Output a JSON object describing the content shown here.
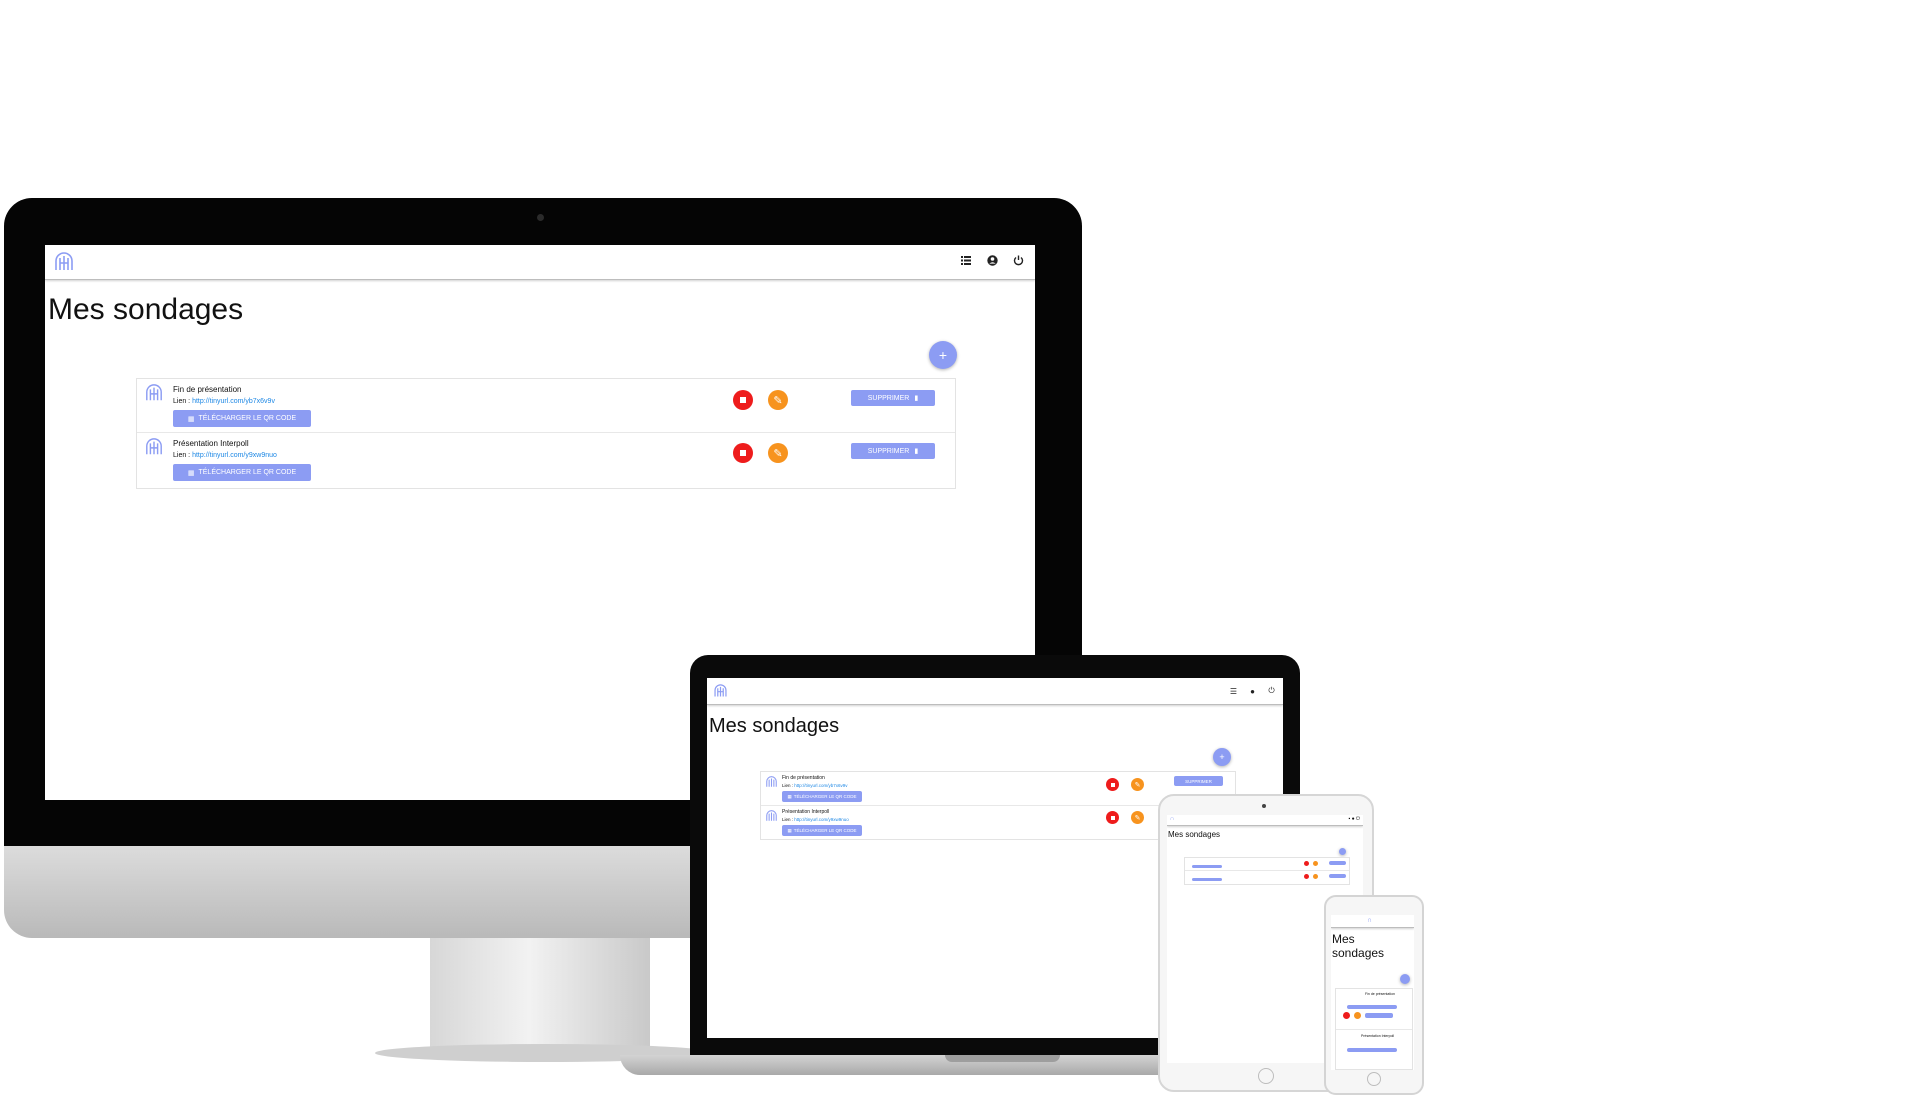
{
  "app": {
    "title": "Mes sondages",
    "fab_label": "+",
    "header_icons": [
      "list-icon",
      "account-icon",
      "power-icon"
    ],
    "polls": [
      {
        "name": "Fin de présentation",
        "link_prefix": "Lien : ",
        "link": "http://tinyurl.com/yb7x6v9v",
        "qr_label": "TÉLÉCHARGER LE QR CODE",
        "delete_label": "SUPPRIMER"
      },
      {
        "name": "Présentation Interpoll",
        "link_prefix": "Lien : ",
        "link": "http://tinyurl.com/y9xw9nuo",
        "qr_label": "TÉLÉCHARGER LE QR CODE",
        "delete_label": "SUPPRIMER"
      }
    ]
  },
  "colors": {
    "primary": "#8c9cf3",
    "stop": "#ee1c1c",
    "edit": "#f7931e",
    "link": "#1e88e5",
    "bezel": "#050505"
  }
}
